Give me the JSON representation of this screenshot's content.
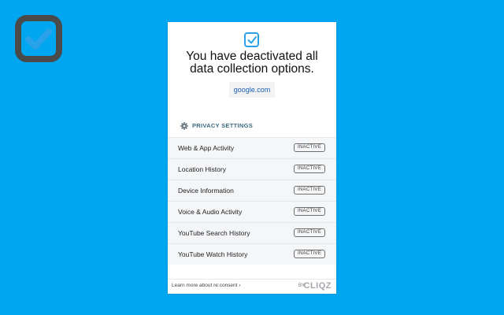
{
  "icons": {
    "big_logo": "check-square-icon",
    "panel_logo": "check-square-icon",
    "settings": "gear-icon"
  },
  "colors": {
    "background": "#00a6f0",
    "logo_dark": "#4a4a4a",
    "logo_accent": "#2aa2e9",
    "link": "#1a5fb4"
  },
  "panel": {
    "headline_line1": "You have deactivated all",
    "headline_line2": "data collection options.",
    "site": "google.com",
    "section_title": "PRIVACY SETTINGS",
    "settings": [
      {
        "label": "Web & App Activity",
        "status": "INACTIVE"
      },
      {
        "label": "Location History",
        "status": "INACTIVE"
      },
      {
        "label": "Device Information",
        "status": "INACTIVE"
      },
      {
        "label": "Voice & Audio Activity",
        "status": "INACTIVE"
      },
      {
        "label": "YouTube Search History",
        "status": "INACTIVE"
      },
      {
        "label": "YouTube Watch History",
        "status": "INACTIVE"
      }
    ],
    "footer": {
      "learn_more": "Learn more about re:consent ›",
      "by": "BY",
      "brand": "CLIQZ"
    }
  }
}
